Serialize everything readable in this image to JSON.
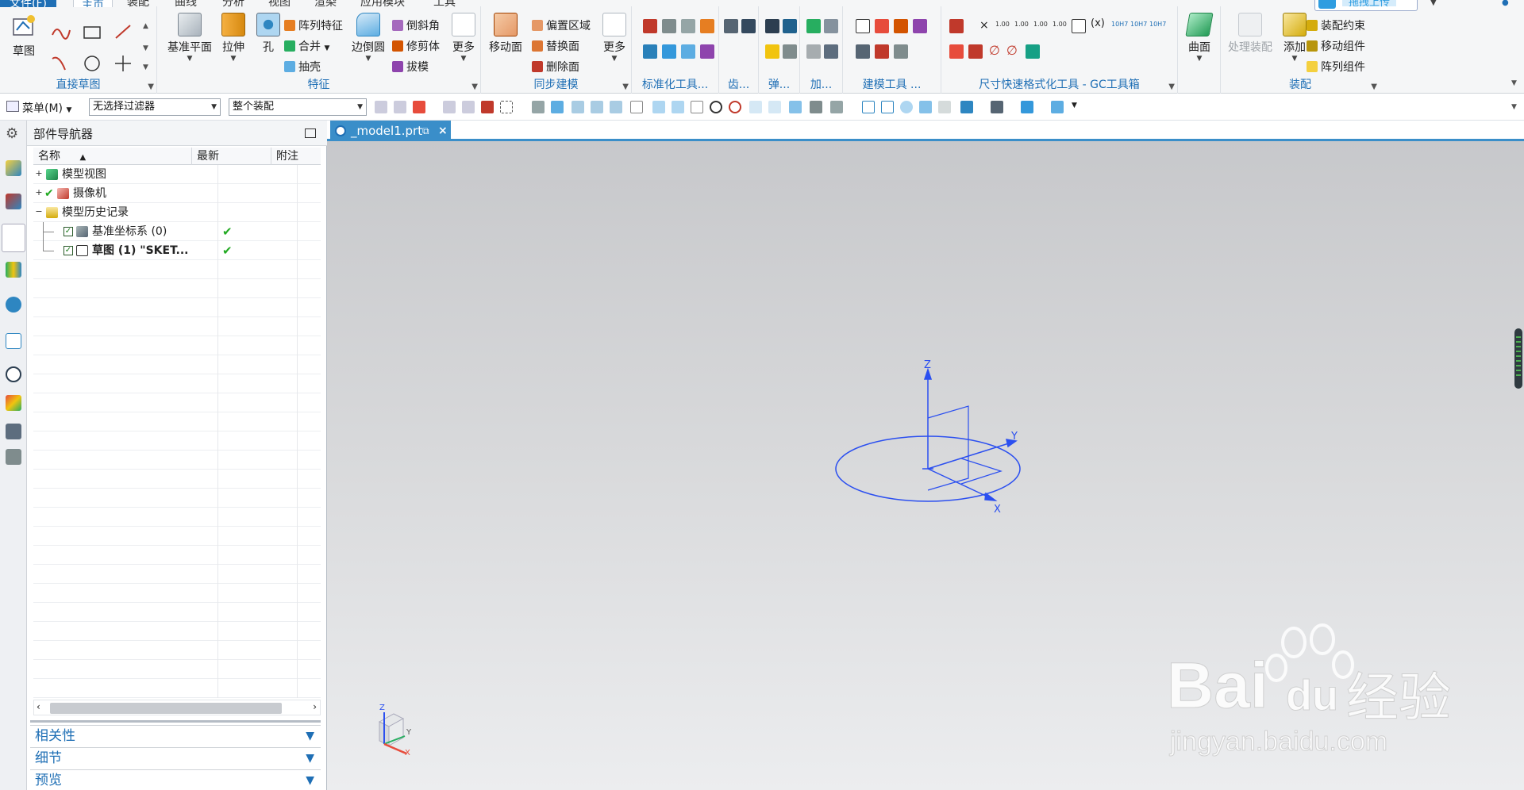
{
  "ribbon": {
    "menu_tabs": [
      "文件(F)",
      "主页",
      "装配",
      "曲线",
      "分析",
      "视图",
      "渲染",
      "应用模块",
      "工具"
    ],
    "active_tab": "主页",
    "upload_button": "拖拽上传",
    "groups": {
      "direct_sketch": {
        "label": "直接草图",
        "sketch_button": "草图"
      },
      "feature": {
        "label": "特征",
        "datum_plane": "基准平面",
        "extrude": "拉伸",
        "hole": "孔",
        "pattern_feature": "阵列特征",
        "unite": "合并",
        "shell": "抽壳",
        "edge_blend": "边倒圆",
        "chamfer": "倒斜角",
        "trim_body": "修剪体",
        "draft": "拔模",
        "more": "更多"
      },
      "sync_modeling": {
        "label": "同步建模",
        "move_face": "移动面",
        "offset_region": "偏置区域",
        "replace_face": "替换面",
        "delete_face": "删除面",
        "more": "更多"
      },
      "standard_tools": {
        "label": "标准化工具..."
      },
      "gear": {
        "label": "齿..."
      },
      "spring": {
        "label": "弹..."
      },
      "add": {
        "label": "加..."
      },
      "modeling_tools": {
        "label": "建模工具 ..."
      },
      "gc_toolbox": {
        "label": "尺寸快速格式化工具 - GC工具箱"
      },
      "surface": {
        "label": "曲面",
        "surface_button": "曲面"
      },
      "assembly": {
        "label": "装配",
        "process_assembly": "处理装配",
        "add": "添加",
        "assembly_constraint": "装配约束",
        "move_component": "移动组件",
        "pattern_component": "阵列组件"
      }
    }
  },
  "toolbar": {
    "menu_label": "菜单(M)",
    "filter_value": "无选择过滤器",
    "scope_value": "整个装配"
  },
  "navigator": {
    "title": "部件导航器",
    "columns": [
      "名称",
      "最新",
      "附注"
    ],
    "rows": [
      {
        "label": "模型视图",
        "level": 0,
        "expander": "+"
      },
      {
        "label": "摄像机",
        "level": 0,
        "expander": "+"
      },
      {
        "label": "模型历史记录",
        "level": 0,
        "expander": "−"
      },
      {
        "label": "基准坐标系 (0)",
        "level": 1,
        "latest": "✔"
      },
      {
        "label": "草图 (1) \"SKET...",
        "level": 1,
        "latest": "✔"
      }
    ],
    "panels": [
      "相关性",
      "细节",
      "预览"
    ]
  },
  "document": {
    "tab_label": "_model1.prt"
  },
  "viewport": {
    "axes": {
      "z": "Z",
      "y": "Y",
      "x": "X"
    },
    "triad": {
      "z": "Z",
      "y": "Y",
      "x": "X"
    }
  },
  "watermark": {
    "brand": "Bai",
    "brand_cn": "经验",
    "du": "du",
    "url": "jingyan.baidu.com"
  },
  "colors": {
    "accent": "#1f6fb5",
    "tab_blue": "#3a8ec9",
    "sketch_blue": "#2b4ff0",
    "check_green": "#22aa22"
  }
}
